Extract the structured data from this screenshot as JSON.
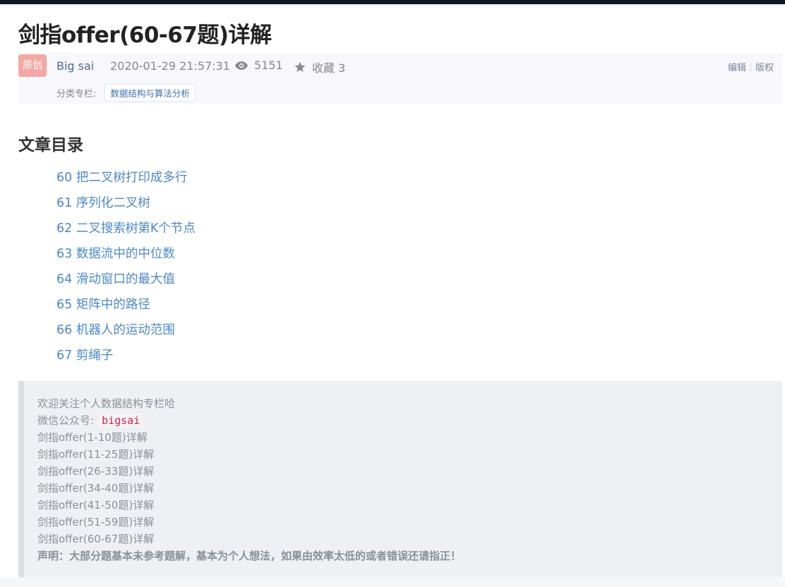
{
  "article": {
    "title": "剑指offer(60-67题)详解",
    "badge": "原创",
    "author": "Big sai",
    "timestamp": "2020-01-29 21:57:31",
    "views": "5151",
    "favorites": "收藏 3",
    "actions": {
      "edit": "编辑",
      "copyright": "版权"
    },
    "category_label": "分类专栏:",
    "category_tag": "数据结构与算法分析"
  },
  "toc": {
    "title": "文章目录",
    "items": [
      "60 把二叉树打印成多行",
      "61 序列化二叉树",
      "62 二叉搜索树第K个节点",
      "63 数据流中的中位数",
      "64 滑动窗口的最大值",
      "65 矩阵中的路径",
      "66 机器人的运动范围",
      "67 剪绳子"
    ]
  },
  "notice": {
    "intro": "欢迎关注个人数据结构专栏哈",
    "wechat_label": "微信公众号:",
    "wechat_id": "bigsai",
    "links": [
      "剑指offer(1-10题)详解",
      "剑指offer(11-25题)详解",
      "剑指offer(26-33题)详解",
      "剑指offer(34-40题)详解",
      "剑指offer(41-50题)详解",
      "剑指offer(51-59题)详解",
      "剑指offer(60-67题)详解"
    ],
    "statement": "声明：大部分题基本未参考题解，基本为个人想法，如果由效率太低的或者错误还请指正！"
  },
  "icons": {
    "views": "eye-icon",
    "favorites": "star-icon"
  },
  "colors": {
    "link": "#4b88c5",
    "badge": "#f4a8a4",
    "code": "#c7254e",
    "header_bar": "#0d1a26"
  }
}
